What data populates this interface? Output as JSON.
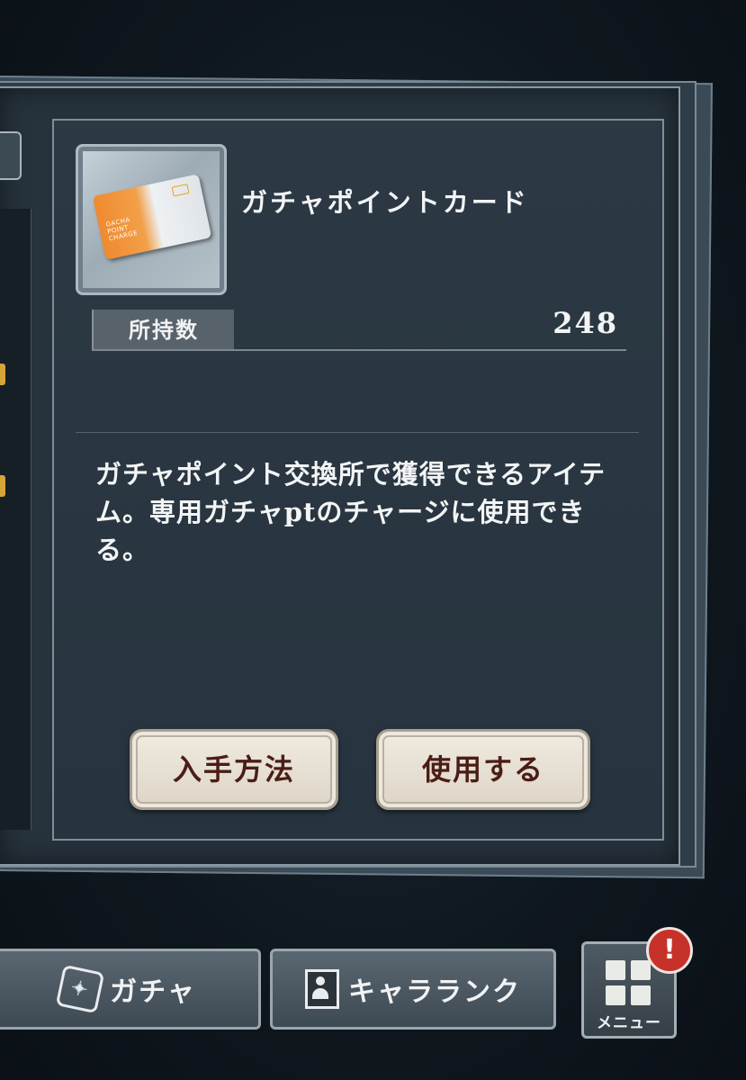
{
  "item": {
    "name": "ガチャポイントカード",
    "card_art_text": "GACHA\nPOINT\nCHARGE",
    "owned_label": "所持数",
    "owned_value": "248",
    "description": "ガチャポイント交換所で獲得できるアイテム。専用ガチャptのチャージに使用できる。"
  },
  "actions": {
    "get_label": "入手方法",
    "use_label": "使用する"
  },
  "bottom_nav": {
    "gacha_label": "ガチャ",
    "gacha_icon": "gacha-die-icon",
    "chararank_label": "キャラランク",
    "chararank_icon": "character-portrait-icon",
    "menu_label": "メニュー",
    "menu_icon": "grid-menu-icon",
    "alert_glyph": "!"
  },
  "colors": {
    "button_text": "#4a1d16",
    "alert": "#c6322a",
    "card_orange": "#f08a2e"
  }
}
